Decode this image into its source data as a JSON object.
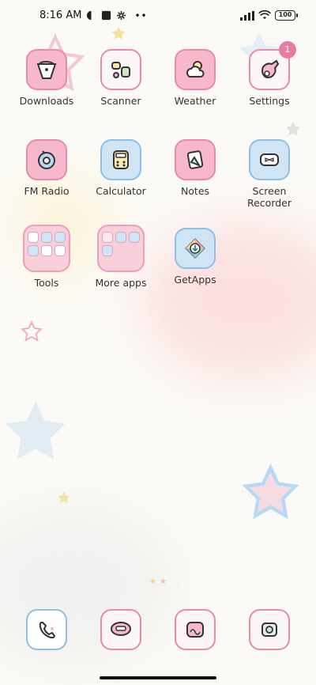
{
  "status_bar": {
    "time": "8:16 AM",
    "battery": "100",
    "icons": [
      "half-moon-icon",
      "square-icon",
      "gear-icon",
      "more-icon",
      "signal-icon",
      "wifi-icon",
      "battery-icon"
    ]
  },
  "apps": [
    {
      "label": "Downloads",
      "icon": "downloads-icon"
    },
    {
      "label": "Scanner",
      "icon": "scanner-icon"
    },
    {
      "label": "Weather",
      "icon": "weather-icon"
    },
    {
      "label": "Settings",
      "icon": "settings-icon",
      "badge": "1"
    },
    {
      "label": "FM Radio",
      "icon": "radio-icon"
    },
    {
      "label": "Calculator",
      "icon": "calculator-icon"
    },
    {
      "label": "Notes",
      "icon": "notes-icon"
    },
    {
      "label": "Screen Recorder",
      "icon": "screen-recorder-icon"
    },
    {
      "label": "Tools",
      "icon": "folder-icon"
    },
    {
      "label": "More apps",
      "icon": "folder-icon"
    },
    {
      "label": "GetApps",
      "icon": "getapps-icon"
    }
  ],
  "dock": [
    {
      "icon": "phone-icon"
    },
    {
      "icon": "messages-icon"
    },
    {
      "icon": "browser-icon"
    },
    {
      "icon": "camera-icon"
    }
  ],
  "colors": {
    "accent_pink": "#e88aa8",
    "accent_blue": "#8ec0e6",
    "badge": "#e87ca0"
  }
}
